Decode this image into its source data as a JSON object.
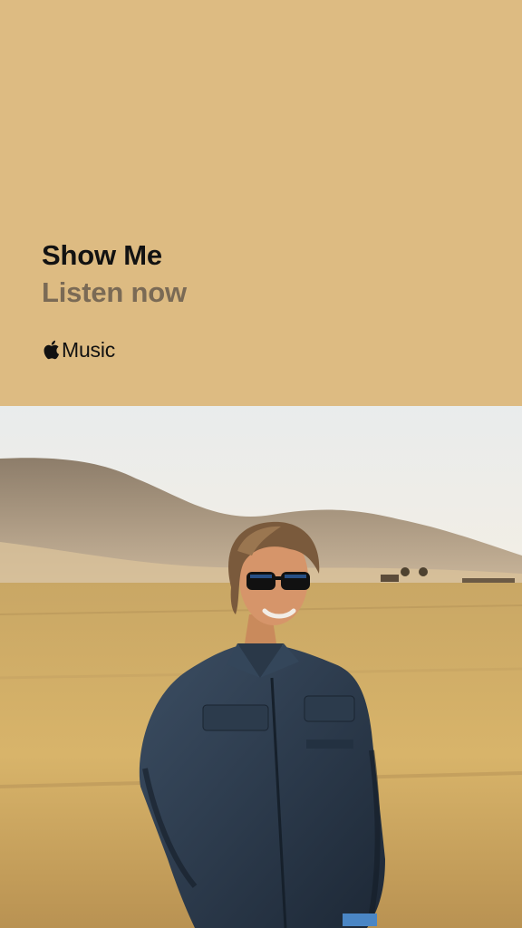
{
  "promo": {
    "title": "Show Me",
    "cta": "Listen now",
    "brand_icon": "apple-logo-icon",
    "brand_name": "Music"
  },
  "artwork": {
    "description_icon": "artist-photo",
    "colors": {
      "panel": "#DDBB82",
      "title": "#121212",
      "cta": "#7A6A55"
    }
  }
}
